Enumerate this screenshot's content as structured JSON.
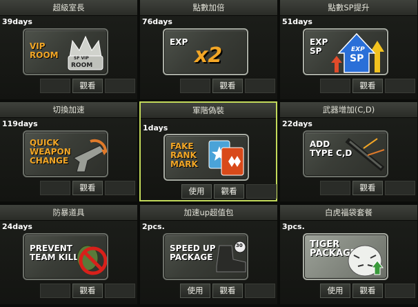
{
  "items": [
    {
      "title": "超級室長",
      "duration": "39days",
      "card_text": "VIP\nROOM",
      "badge_text": "SF VIP",
      "badge_sub": "ROOM",
      "buttons": [
        "觀看"
      ]
    },
    {
      "title": "點數加倍",
      "duration": "76days",
      "card_text": "EXP",
      "big_text": "x2",
      "buttons": [
        "觀看"
      ]
    },
    {
      "title": "點數SP提升",
      "duration": "51days",
      "card_text": "EXP\nSP",
      "arrow_top": "EXP",
      "arrow_bottom": "SP",
      "buttons": [
        "觀看"
      ]
    },
    {
      "title": "切換加速",
      "duration": "119days",
      "card_text": "QUICK\nWEAPON\nCHANGE",
      "buttons": [
        "觀看"
      ]
    },
    {
      "title": "軍階偽裝",
      "duration": "1days",
      "card_text": "FAKE\nRANK\nMARK",
      "buttons": [
        "使用",
        "觀看"
      ]
    },
    {
      "title": "武器增加(C,D)",
      "duration": "22days",
      "card_text": "ADD\nTYPE C,D",
      "buttons": [
        "觀看"
      ]
    },
    {
      "title": "防暴道具",
      "duration": "24days",
      "card_text": "PREVENT\nTEAM KILL",
      "buttons": [
        "觀看"
      ]
    },
    {
      "title": "加速up超值包",
      "duration": "2pcs.",
      "card_text": "SPEED UP\nPACKAGE",
      "badge_text": "30",
      "buttons": [
        "使用",
        "觀看"
      ]
    },
    {
      "title": "白虎福袋套餐",
      "duration": "3pcs.",
      "card_text": "TIGER\nPACKAGE",
      "buttons": [
        "使用",
        "觀看"
      ]
    }
  ],
  "selected_index": 4,
  "colors": {
    "accent": "#c3da5a",
    "orange": "#f2a626",
    "sp_blue": "#2a6fd8"
  }
}
